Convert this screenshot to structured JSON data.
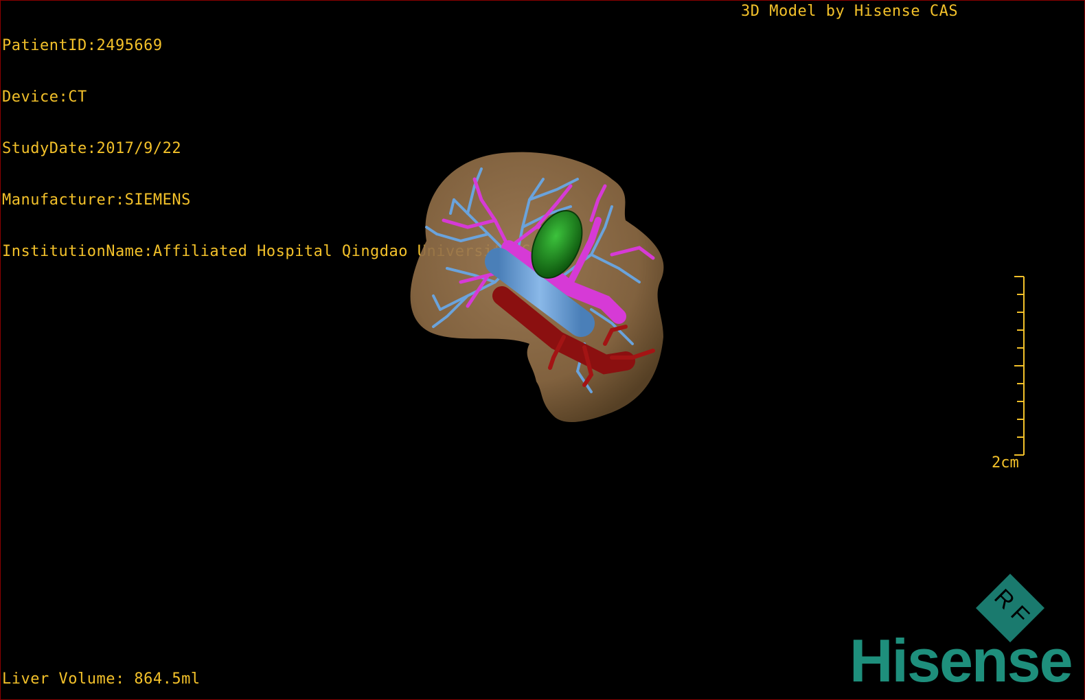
{
  "overlay": {
    "text_color": "#f3c12a",
    "patient_id": "PatientID:2495669",
    "device": "Device:CT",
    "study_date": "StudyDate:2017/9/22",
    "manufacturer": "Manufacturer:SIEMENS",
    "institution": "InstitutionName:Affiliated Hospital Qingdao University-C",
    "model_credit": "3D Model by Hisense CAS",
    "liver_volume": "Liver Volume: 864.5ml"
  },
  "scale_bar": {
    "label": "2cm",
    "icon": "scale-ruler-icon"
  },
  "brand": {
    "name": "Hisense",
    "color": "#1e8f7c",
    "cube_color": "#1a7a6e",
    "cube_letters": "R F",
    "icon": "orientation-cube-icon"
  },
  "model": {
    "icon": "liver-3d-model",
    "liver_color": "#8c6a44",
    "portal_vein_color": "#6aa3dc",
    "hepatic_vein_color": "#d63ad6",
    "artery_color": "#8b1010",
    "lesion_color": "#1f8a1f"
  }
}
